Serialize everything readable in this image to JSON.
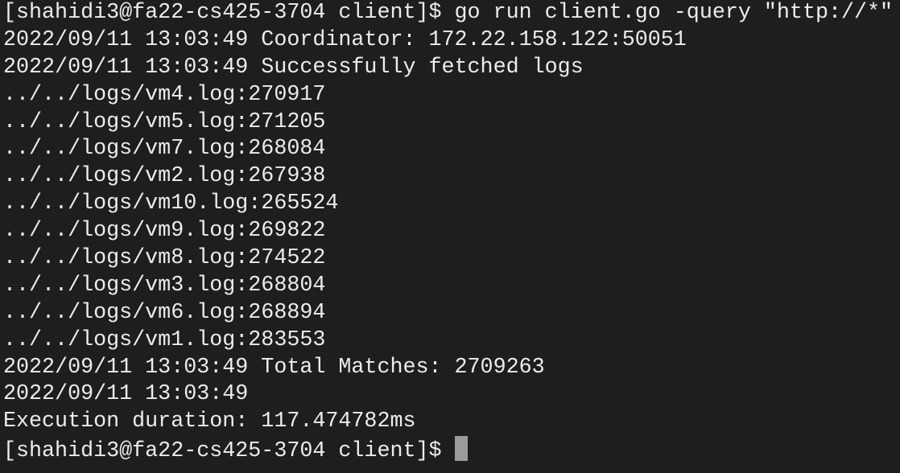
{
  "terminal": {
    "prompt": "[shahidi3@fa22-cs425-3704 client]$ ",
    "command": "go run client.go -query \"http://*\"",
    "output": [
      "2022/09/11 13:03:49 Coordinator: 172.22.158.122:50051",
      "2022/09/11 13:03:49 Successfully fetched logs",
      "../../logs/vm4.log:270917",
      "../../logs/vm5.log:271205",
      "../../logs/vm7.log:268084",
      "../../logs/vm2.log:267938",
      "../../logs/vm10.log:265524",
      "../../logs/vm9.log:269822",
      "../../logs/vm8.log:274522",
      "../../logs/vm3.log:268804",
      "../../logs/vm6.log:268894",
      "../../logs/vm1.log:283553",
      "2022/09/11 13:03:49 Total Matches: 2709263",
      "2022/09/11 13:03:49",
      "Execution duration: 117.474782ms"
    ],
    "final_prompt": "[shahidi3@fa22-cs425-3704 client]$ "
  }
}
